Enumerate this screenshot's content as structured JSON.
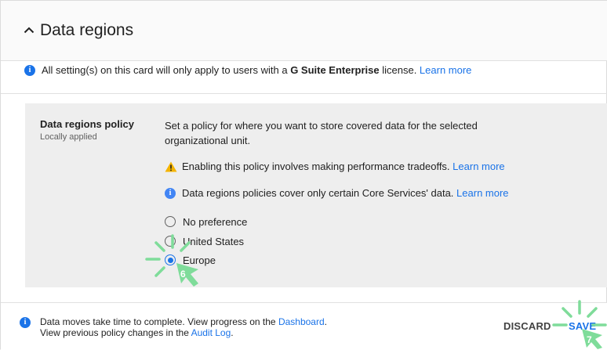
{
  "header": {
    "title": "Data regions",
    "collapse_icon": "chevron-up-icon"
  },
  "notice": {
    "text_before": "All setting(s) on this card will only apply to users with a ",
    "text_bold": "G Suite Enterprise",
    "text_after": " license. ",
    "link": "Learn more"
  },
  "policy": {
    "label": "Data regions policy",
    "sublabel": "Locally applied",
    "description": "Set a policy for where you want to store covered data for the selected organizational unit.",
    "warning": {
      "text": "Enabling this policy involves making performance tradeoffs. ",
      "link": "Learn more"
    },
    "info": {
      "text": "Data regions policies cover only certain Core Services' data. ",
      "link": "Learn more"
    },
    "options": [
      {
        "label": "No preference",
        "selected": false
      },
      {
        "label": "United States",
        "selected": false
      },
      {
        "label": "Europe",
        "selected": true
      }
    ]
  },
  "footer": {
    "line1_text": "Data moves take time to complete. View progress on the ",
    "line1_link": "Dashboard",
    "line1_end": ".",
    "line2_text": "View previous policy changes in the ",
    "line2_link": "Audit Log",
    "line2_end": ".",
    "discard_label": "DISCARD",
    "save_label": "SAVE"
  },
  "annotations": [
    {
      "step": "6",
      "color": "#7fdc9a"
    },
    {
      "step": "7",
      "color": "#7fdc9a"
    }
  ],
  "colors": {
    "link": "#1a73e8",
    "info": "#4285f4",
    "warning": "#f4b400",
    "panel": "#eeeeee",
    "annotation": "#7fdc9a"
  }
}
